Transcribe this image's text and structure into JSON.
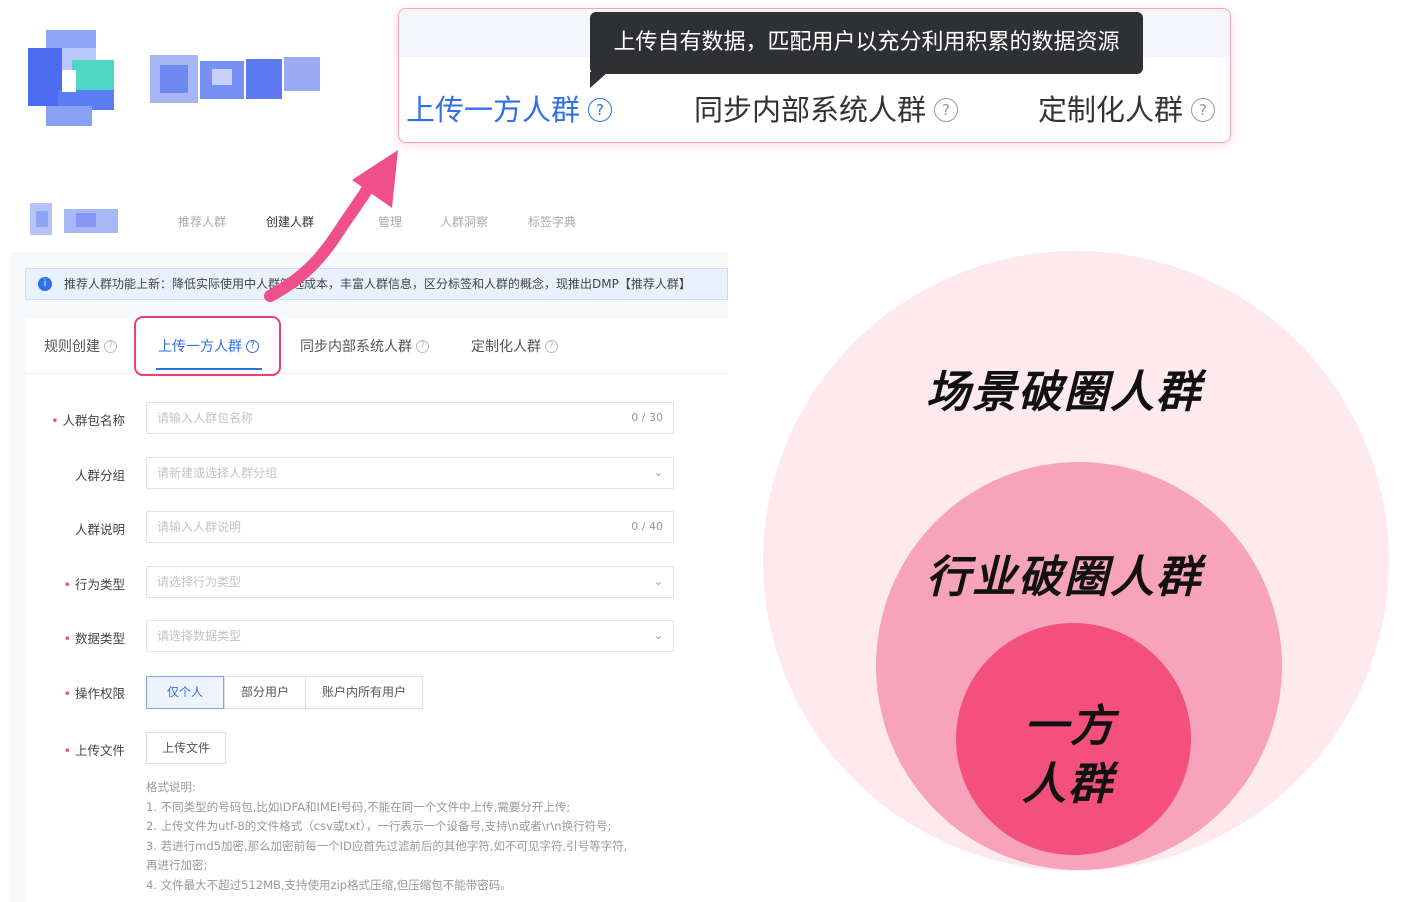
{
  "zoom": {
    "tooltip": "上传自有数据，匹配用户以充分利用积累的数据资源",
    "tabs": [
      {
        "label": "上传一方人群",
        "help": "?"
      },
      {
        "label": "同步内部系统人群",
        "help": "?"
      },
      {
        "label": "定制化人群",
        "help": "?"
      }
    ]
  },
  "topnav": [
    "推荐人群",
    "创建人群",
    "管理",
    "人群洞察",
    "标签字典"
  ],
  "notice": {
    "icon": "i",
    "text": "推荐人群功能上新：降低实际使用中人群筛选成本，丰富人群信息，区分标签和人群的概念，现推出DMP【推荐人群】"
  },
  "tabs": [
    {
      "label": "规则创建"
    },
    {
      "label": "上传一方人群"
    },
    {
      "label": "同步内部系统人群"
    },
    {
      "label": "定制化人群"
    }
  ],
  "form": {
    "name": {
      "label": "人群包名称",
      "placeholder": "请输入人群包名称",
      "counter": "0 / 30"
    },
    "group": {
      "label": "人群分组",
      "placeholder": "请新建或选择人群分组"
    },
    "desc": {
      "label": "人群说明",
      "placeholder": "请输入人群说明",
      "counter": "0 / 40"
    },
    "behavior": {
      "label": "行为类型",
      "placeholder": "请选择行为类型"
    },
    "datatype": {
      "label": "数据类型",
      "placeholder": "请选择数据类型"
    },
    "permission": {
      "label": "操作权限",
      "options": [
        "仅个人",
        "部分用户",
        "账户内所有用户"
      ],
      "selected": "仅个人"
    },
    "upload": {
      "label": "上传文件",
      "button": "上传文件"
    },
    "notes": {
      "title": "格式说明:",
      "items": [
        "1. 不同类型的号码包,比如IDFA和IMEI号码,不能在同一个文件中上传,需要分开上传;",
        "2. 上传文件为utf-8的文件格式（csv或txt），一行表示一个设备号,支持\\n或者\\r\\n换行符号;",
        "3. 若进行md5加密,那么加密前每一个ID应首先过滤前后的其他字符,如不可见字符,引号等字符,",
        "再进行加密;",
        "4. 文件最大不超过512MB,支持使用zip格式压缩,但压缩包不能带密码。"
      ]
    }
  },
  "circles": {
    "outer": "场景破圈人群",
    "middle": "行业破圈人群",
    "inner_line1": "一方",
    "inner_line2": "人群"
  },
  "colors": {
    "accent_blue": "#2f6fe8",
    "highlight_pink": "#e93f7d",
    "circle_outer": "#fde9ee",
    "circle_middle": "#f7a3bb",
    "circle_inner": "#f4507d"
  }
}
